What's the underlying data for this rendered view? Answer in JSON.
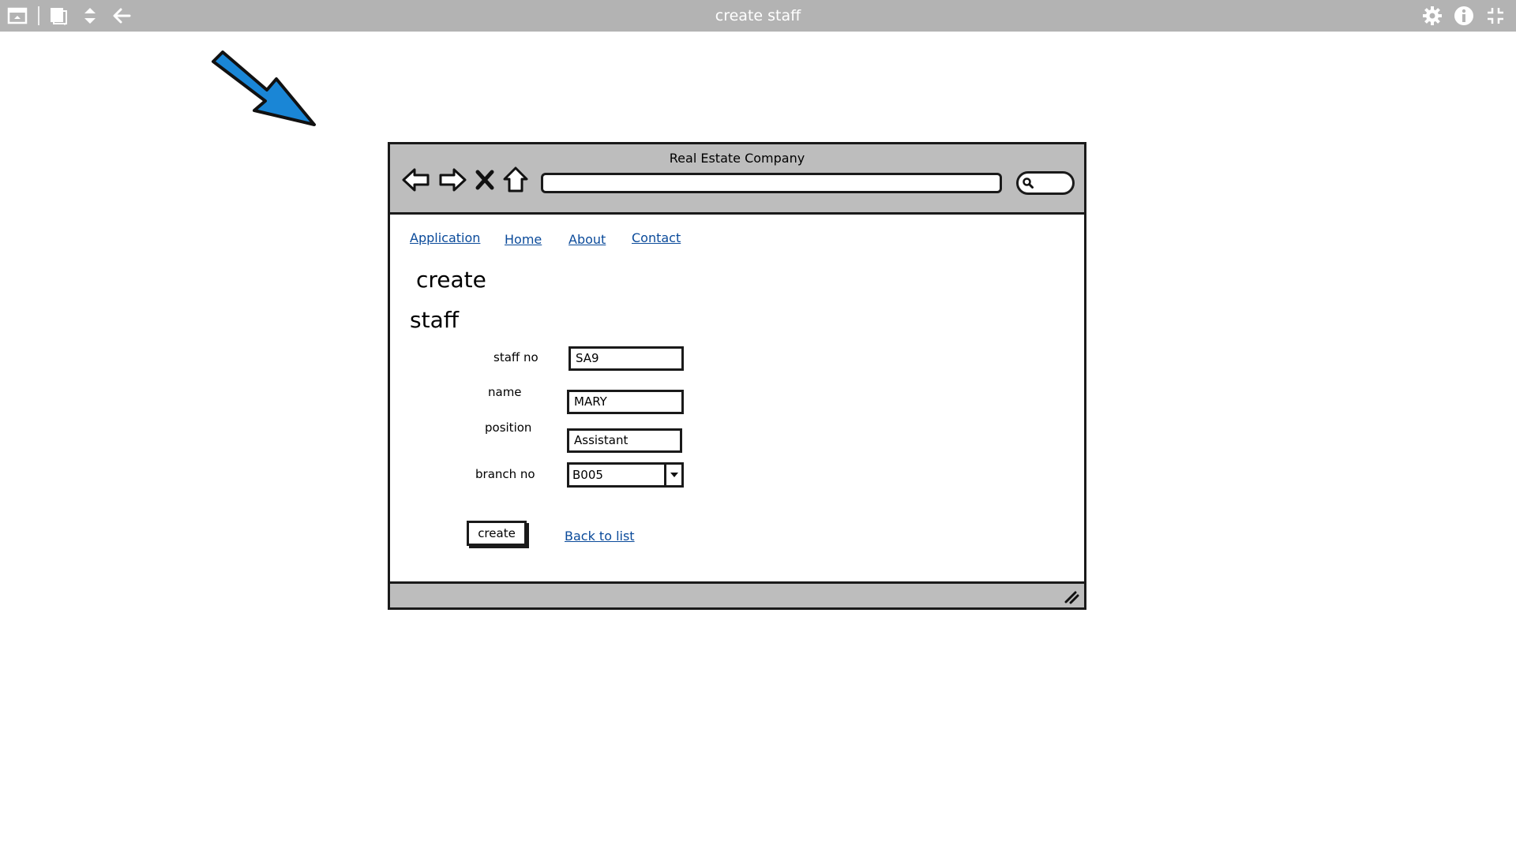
{
  "app": {
    "title": "create staff",
    "bar_color": "#b3b3b3",
    "left_icons": [
      "window-icon",
      "copy-icon",
      "sort-updown-icon",
      "back-arrow-icon"
    ],
    "right_icons": [
      "gear-icon",
      "info-icon",
      "collapse-icon"
    ]
  },
  "decor": {
    "arrow_color": "#1a86d6"
  },
  "browser": {
    "title": "Real Estate Company",
    "nav_icons": [
      "back-icon",
      "forward-icon",
      "close-x-icon",
      "home-icon"
    ],
    "url_value": "",
    "links": [
      "Application",
      "Home",
      "About",
      "Contact"
    ],
    "link_color": "#0a4a9a"
  },
  "page": {
    "heading1": "create",
    "heading2": "staff"
  },
  "form": {
    "staff_no_label": "staff no",
    "staff_no_value": "SA9",
    "name_label": "name",
    "name_value": "MARY",
    "position_label": "position",
    "position_value": "Assistant",
    "branch_no_label": "branch no",
    "branch_no_value": "B005",
    "create_label": "create",
    "back_label": "Back to list"
  }
}
